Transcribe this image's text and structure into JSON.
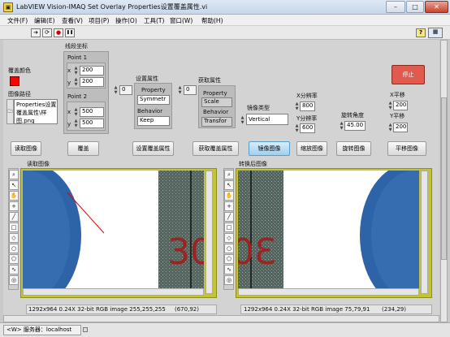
{
  "window": {
    "title": "LabVIEW Vision-IMAQ Set Overlay Properties设置覆盖属性.vi",
    "app_icon": "labview-vi-icon"
  },
  "menu": [
    "文件(F)",
    "编辑(E)",
    "查看(V)",
    "项目(P)",
    "操作(O)",
    "工具(T)",
    "窗口(W)",
    "帮助(H)"
  ],
  "toolbar": {
    "run": "➔",
    "run_continuous": "⟳",
    "abort": "●",
    "pause": "❚❚",
    "help": "?"
  },
  "controls": {
    "overlay_color_label": "覆盖颜色",
    "overlay_color": "#ff0000",
    "image_path_label": "图像路径",
    "image_path_value": "Properties设置覆盖属性\\样图.png",
    "line_coords_label": "线段坐标",
    "point1_label": "Point 1",
    "point2_label": "Point 2",
    "p1x": "200",
    "p1y": "200",
    "p2x": "500",
    "p2y": "500",
    "x_label": "x",
    "y_label": "y",
    "set_props_label": "设置属性",
    "set_index": "0",
    "set_property": "Property",
    "set_property_value": "Symmetr",
    "set_behavior": "Behavior",
    "set_behavior_value": "Keep",
    "get_props_label": "获取属性",
    "get_index": "0",
    "get_property": "Property",
    "get_property_value": "Scale",
    "get_behavior": "Behavior",
    "get_behavior_value": "Transfor",
    "mirror_type_label": "镜像类型",
    "mirror_type_value": "Vertical",
    "x_res_label": "X分辨率",
    "x_res": "800",
    "y_res_label": "Y分辨率",
    "y_res": "600",
    "rot_angle_label": "旋转角度",
    "rot_angle": "45.00",
    "x_shift_label": "X平移",
    "x_shift": "200",
    "y_shift_label": "Y平移",
    "y_shift": "200",
    "stop_label": "停止",
    "stop_color": "#e05a4e"
  },
  "buttons": {
    "read_image": "读取图像",
    "overlay": "覆盖",
    "set_overlay_props": "设置覆盖属性",
    "get_overlay_props": "获取覆盖属性",
    "mirror_image": "镜像图像",
    "scale_image": "缩放图像",
    "rotate_image": "旋转图像",
    "translate_image": "平移图像"
  },
  "display_left": {
    "label": "读取图像",
    "info": "1292x964 0.24X 32-bit RGB image 255,255,255",
    "coords": "(670,92)",
    "digits": "30"
  },
  "display_right": {
    "label": "转换后图像",
    "info": "1292x964 0.24X 32-bit RGB image 75,79,91",
    "coords": "(234,29)",
    "digits": "30"
  },
  "status_bar": {
    "text": "<W> 服务器：localhost"
  }
}
